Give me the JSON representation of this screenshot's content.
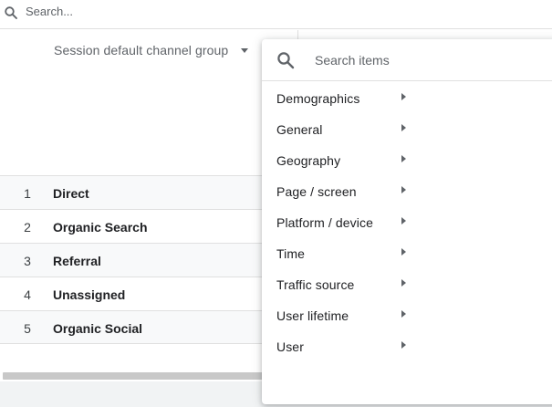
{
  "top_search": {
    "placeholder": "Search..."
  },
  "dimension_header": {
    "label": "Session default channel group"
  },
  "table": {
    "rows": [
      {
        "index": "1",
        "name": "Direct"
      },
      {
        "index": "2",
        "name": "Organic Search"
      },
      {
        "index": "3",
        "name": "Referral"
      },
      {
        "index": "4",
        "name": "Unassigned"
      },
      {
        "index": "5",
        "name": "Organic Social"
      }
    ]
  },
  "dropdown": {
    "search_placeholder": "Search items",
    "items": [
      {
        "label": "Demographics"
      },
      {
        "label": "General"
      },
      {
        "label": "Geography"
      },
      {
        "label": "Page / screen"
      },
      {
        "label": "Platform / device"
      },
      {
        "label": "Time"
      },
      {
        "label": "Traffic source"
      },
      {
        "label": "User lifetime"
      },
      {
        "label": "User"
      }
    ]
  },
  "icons": {
    "top_search": "search-icon",
    "dropdown_search": "search-icon",
    "dimension_picker": "caret-down-icon",
    "submenu": "chevron-right-icon"
  },
  "colors": {
    "text_primary": "#202124",
    "text_secondary": "#5f6368",
    "divider": "#e0e0e0",
    "row_shaded": "#f8f9fa",
    "bottom_strip": "#f1f3f4"
  }
}
